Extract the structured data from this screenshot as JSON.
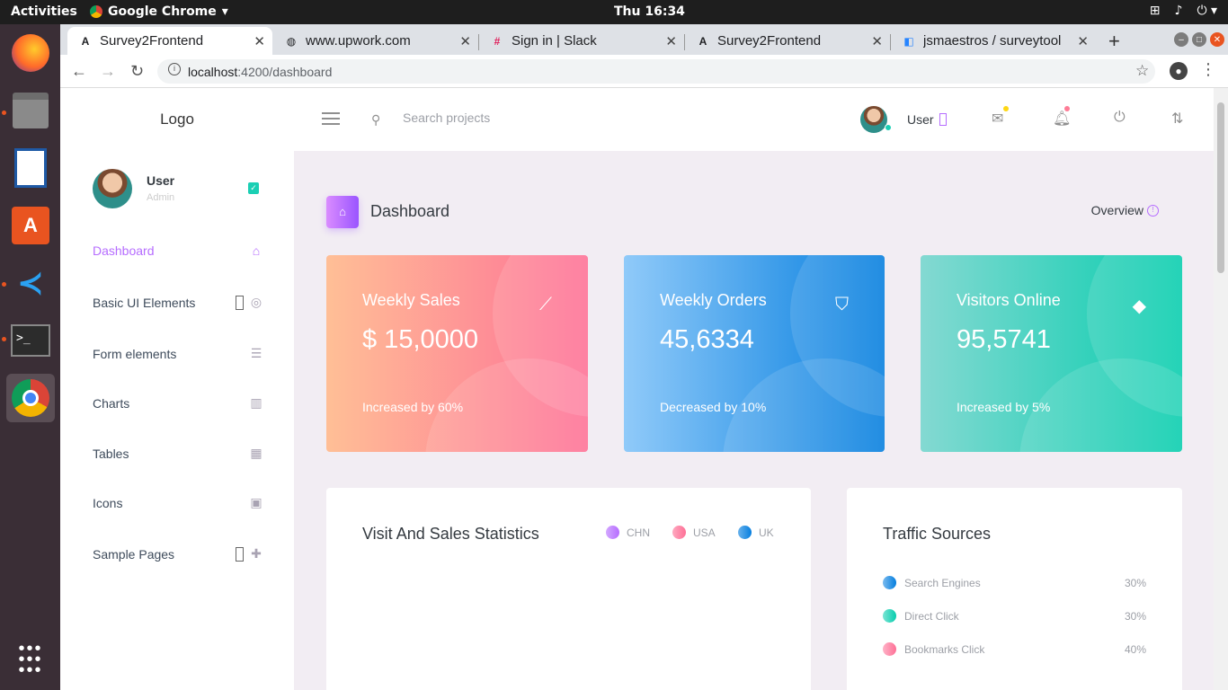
{
  "os": {
    "activities": "Activities",
    "app_name": "Google Chrome",
    "clock": "Thu 16:34"
  },
  "browser": {
    "tabs": [
      {
        "title": "Survey2Frontend",
        "icon": "angular-icon"
      },
      {
        "title": "www.upwork.com",
        "icon": "globe-icon"
      },
      {
        "title": "Sign in | Slack",
        "icon": "slack-icon"
      },
      {
        "title": "Survey2Frontend",
        "icon": "angular-icon"
      },
      {
        "title": "jsmaestros / surveytool",
        "icon": "bitbucket-icon"
      }
    ],
    "url_host": "localhost",
    "url_path": ":4200/dashboard"
  },
  "sidebar": {
    "logo": "Logo",
    "user_name": "User",
    "user_role": "Admin",
    "items": [
      {
        "label": "Dashboard",
        "icon": "home-icon",
        "active": true
      },
      {
        "label": "Basic UI Elements",
        "icon": "crosshairs-icon"
      },
      {
        "label": "Form elements",
        "icon": "list-icon"
      },
      {
        "label": "Charts",
        "icon": "bar-chart-icon"
      },
      {
        "label": "Tables",
        "icon": "table-icon"
      },
      {
        "label": "Icons",
        "icon": "contacts-icon"
      },
      {
        "label": "Sample Pages",
        "icon": "medical-bag-icon"
      }
    ]
  },
  "header": {
    "search_placeholder": "Search projects",
    "user_name": "User"
  },
  "page": {
    "title": "Dashboard",
    "overview": "Overview"
  },
  "cards": [
    {
      "title": "Weekly Sales",
      "value": "$ 15,0000",
      "footer": "Increased by 60%",
      "icon": "chart-line-icon",
      "colors": [
        "#ffbf96",
        "#fe7096"
      ]
    },
    {
      "title": "Weekly Orders",
      "value": "45,6334",
      "footer": "Decreased by 10%",
      "icon": "bookmark-icon",
      "colors": [
        "#90caf9",
        "#047edf"
      ]
    },
    {
      "title": "Visitors Online",
      "value": "95,5741",
      "footer": "Increased by 5%",
      "icon": "diamond-icon",
      "colors": [
        "#84d9d2",
        "#07cdae"
      ]
    }
  ],
  "stats": {
    "title": "Visit And Sales Statistics",
    "legend": [
      {
        "label": "CHN",
        "color": "#b66dff"
      },
      {
        "label": "USA",
        "color": "#fe7096"
      },
      {
        "label": "UK",
        "color": "#047edf"
      }
    ]
  },
  "traffic": {
    "title": "Traffic Sources",
    "rows": [
      {
        "label": "Search Engines",
        "value": "30%",
        "color": "#047edf"
      },
      {
        "label": "Direct Click",
        "value": "30%",
        "color": "#07cdae"
      },
      {
        "label": "Bookmarks Click",
        "value": "40%",
        "color": "#fe7096"
      }
    ]
  }
}
